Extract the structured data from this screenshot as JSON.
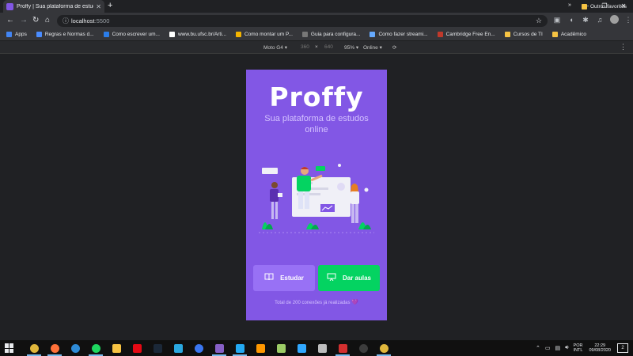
{
  "browser": {
    "tab": {
      "title": "Proffy | Sua plataforma de estudos"
    },
    "address": {
      "host": "localhost",
      "port": ":5500"
    },
    "bookmarks": [
      {
        "label": "Apps",
        "color": "#4285f4"
      },
      {
        "label": "Regras e Normas d...",
        "color": "#4a8cff"
      },
      {
        "label": "Como escrever um...",
        "color": "#2b7de9"
      },
      {
        "label": "www.bu.ufsc.br/Arti...",
        "color": "#ffffff"
      },
      {
        "label": "Como montar um P...",
        "color": "#f4b400"
      },
      {
        "label": "Guia para configura...",
        "color": "#777777"
      },
      {
        "label": "Como fazer streami...",
        "color": "#66aaff"
      },
      {
        "label": "Cambridge Free En...",
        "color": "#c0392b"
      },
      {
        "label": "Cursos de TI",
        "color": "#f6c343"
      },
      {
        "label": "Acadêmico",
        "color": "#f6c343"
      }
    ],
    "bookmarks_more": "»",
    "other_bookmarks": "Outros favoritos"
  },
  "device_toolbar": {
    "device": "Moto G4",
    "width": "360",
    "times": "×",
    "height": "640",
    "zoom": "95%",
    "network": "Online"
  },
  "page": {
    "logo": "Proffy",
    "tagline": "Sua plataforma de estudos online",
    "study_button": "Estudar",
    "give_classes_button": "Dar aulas",
    "connections_text": "Total de 200 conexões já realizadas",
    "heart": "💜",
    "colors": {
      "primary": "#8257e5",
      "primary_light": "#9871f5",
      "secondary": "#04d361"
    }
  },
  "taskbar": {
    "apps": [
      {
        "name": "chrome",
        "color": "#e0b73c"
      },
      {
        "name": "firefox",
        "color": "#ff7139"
      },
      {
        "name": "edge",
        "color": "#2e8bd7"
      },
      {
        "name": "spotify",
        "color": "#1ed760"
      },
      {
        "name": "file-explorer",
        "color": "#f6c343"
      },
      {
        "name": "netflix",
        "color": "#e50914"
      },
      {
        "name": "steam",
        "color": "#1b2838"
      },
      {
        "name": "discord-like",
        "color": "#2aa8e0"
      },
      {
        "name": "signal",
        "color": "#3a76f0"
      },
      {
        "name": "visual-studio",
        "color": "#865fc5"
      },
      {
        "name": "vscode",
        "color": "#23a9f2"
      },
      {
        "name": "sublime",
        "color": "#ff9800"
      },
      {
        "name": "launcher",
        "color": "#9ccc65"
      },
      {
        "name": "photoshop",
        "color": "#31a8ff"
      },
      {
        "name": "notes",
        "color": "#bdbdbd"
      },
      {
        "name": "recorder",
        "color": "#d32f2f"
      },
      {
        "name": "obs",
        "color": "#3c3c3c"
      },
      {
        "name": "chrome-dev",
        "color": "#e0b73c"
      }
    ],
    "language_top": "POR",
    "language_bottom": "INTL",
    "time": "22:29",
    "date": "09/08/2020",
    "notifications": "2"
  }
}
